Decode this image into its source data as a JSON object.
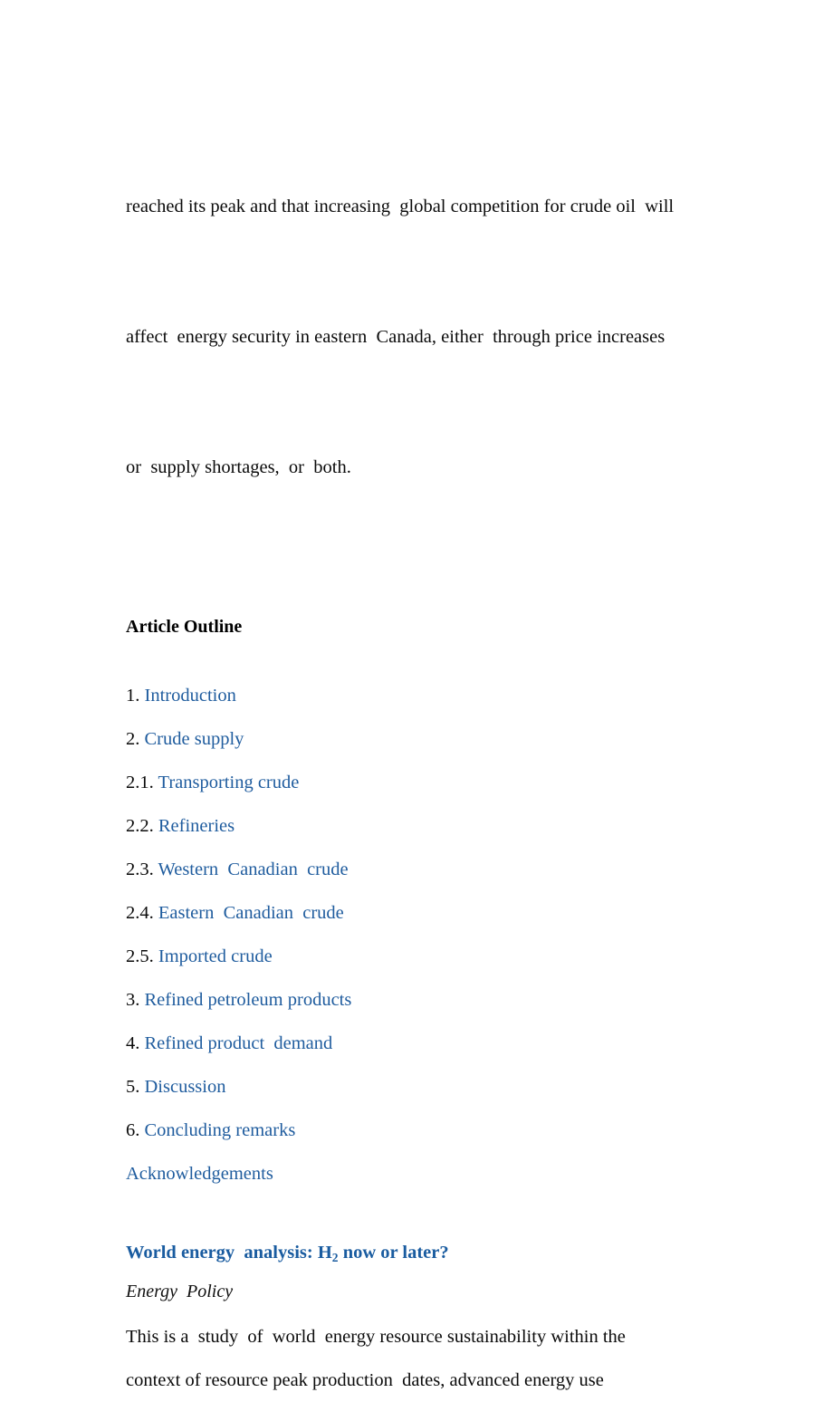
{
  "document": {
    "top_paragraph": {
      "lines": [
        "reached its peak and that increasing  global competition for crude oil  will",
        "affect  energy security in eastern  Canada, either  through price increases",
        "or  supply shortages,  or  both."
      ]
    },
    "outline_heading": "Article Outline",
    "outline_items": [
      {
        "number": "1. ",
        "label": "Introduction"
      },
      {
        "number": "2. ",
        "label": "Crude supply"
      },
      {
        "number": "2.1. ",
        "label": "Transporting crude"
      },
      {
        "number": "2.2. ",
        "label": "Refineries"
      },
      {
        "number": "2.3. ",
        "label": "Western  Canadian  crude"
      },
      {
        "number": "2.4. ",
        "label": "Eastern  Canadian  crude"
      },
      {
        "number": "2.5. ",
        "label": "Imported crude"
      },
      {
        "number": "3. ",
        "label": "Refined petroleum products"
      },
      {
        "number": "4. ",
        "label": "Refined product  demand"
      },
      {
        "number": "5. ",
        "label": "Discussion"
      },
      {
        "number": "6. ",
        "label": "Concluding remarks"
      },
      {
        "number": "",
        "label": "Acknowledgements"
      }
    ],
    "next_article": {
      "title_before_sub": "World energy  analysis: H",
      "title_subscript": "2",
      "title_after_sub": " now or later?",
      "journal": "Energy  Policy",
      "abstract_lines": [
        "This is a  study  of  world  energy resource sustainability within the",
        "context of resource peak production  dates, advanced energy use"
      ]
    },
    "colors": {
      "link_blue": "#1f5c9e",
      "title_blue": "#1a5ca0",
      "body_text": "#0a0a0a",
      "page_background": "#ffffff"
    }
  }
}
